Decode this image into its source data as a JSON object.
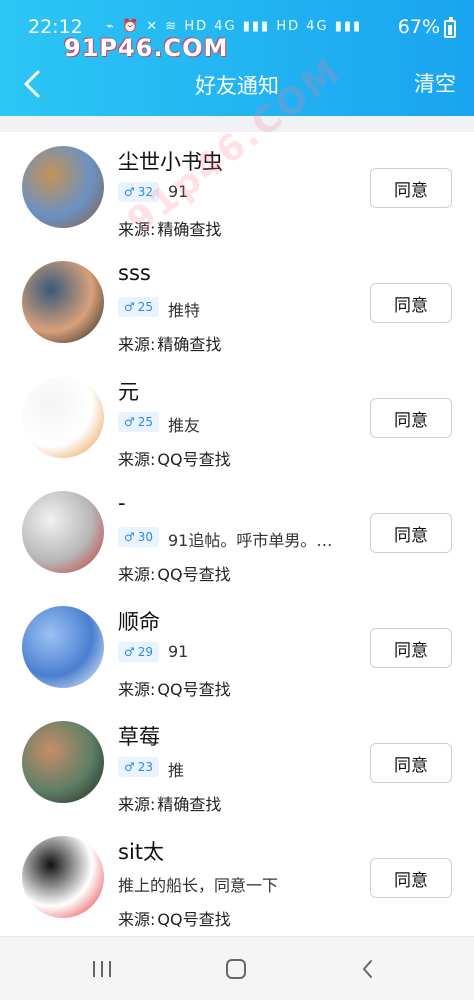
{
  "status_bar": {
    "time": "22:12",
    "icons_text": "⌁ ⏰ ✕ ≋ HD 4G ▮▮▮ HD 4G ▮▮▮",
    "battery": "67%"
  },
  "watermark": {
    "top": "91P46.COM",
    "diagonal": "91p46.COM"
  },
  "nav": {
    "back_icon": "chevron-left-icon",
    "title": "好友通知",
    "clear_label": "清空"
  },
  "items": [
    {
      "name": "尘世小书虫",
      "age": "32",
      "age_symbol": "♂",
      "message": "91",
      "source_label": "来源:",
      "source": "精确查找",
      "agree": "同意",
      "avatar_colors": [
        "#6a91c4",
        "#c39256",
        "#8a5c33"
      ]
    },
    {
      "name": "sss",
      "age": "25",
      "age_symbol": "♂",
      "message": "推特",
      "source_label": "来源:",
      "source": "精确查找",
      "agree": "同意",
      "avatar_colors": [
        "#d8a07a",
        "#385a7a",
        "#1a1a1a"
      ]
    },
    {
      "name": "元",
      "age": "25",
      "age_symbol": "♂",
      "message": "推友",
      "source_label": "来源:",
      "source": "QQ号查找",
      "agree": "同意",
      "avatar_colors": [
        "#ffffff",
        "#f4f4f4",
        "#e28a2e"
      ]
    },
    {
      "name": "-",
      "age": "30",
      "age_symbol": "♂",
      "message": "91追帖。呼市单男。…",
      "source_label": "来源:",
      "source": "QQ号查找",
      "agree": "同意",
      "avatar_colors": [
        "#b7b7b7",
        "#f1f1f1",
        "#c62c2c"
      ]
    },
    {
      "name": "顺命",
      "age": "29",
      "age_symbol": "♂",
      "message": "91",
      "source_label": "来源:",
      "source": "QQ号查找",
      "agree": "同意",
      "avatar_colors": [
        "#4a7fd0",
        "#9cc2f4",
        "#ffffff"
      ]
    },
    {
      "name": "草莓",
      "age": "23",
      "age_symbol": "♂",
      "message": "推",
      "source_label": "来源:",
      "source": "精确查找",
      "agree": "同意",
      "avatar_colors": [
        "#5d7f65",
        "#c78d6a",
        "#1f1f1f"
      ]
    },
    {
      "name": "sit太",
      "age": "",
      "age_symbol": "",
      "message": "推上的船长，同意一下",
      "source_label": "来源:",
      "source": "QQ号查找",
      "agree": "同意",
      "avatar_colors": [
        "#ffffff",
        "#111111",
        "#e11b1b"
      ]
    }
  ],
  "bottom_nav": {
    "recent_icon": "recent-apps-icon",
    "home_icon": "home-icon",
    "back_icon": "back-icon"
  },
  "colors": {
    "header_gradient_left": "#2cc6f5",
    "header_gradient_right": "#1aa4f0",
    "badge_bg": "#e8f3fd",
    "badge_text": "#2a8de6"
  }
}
